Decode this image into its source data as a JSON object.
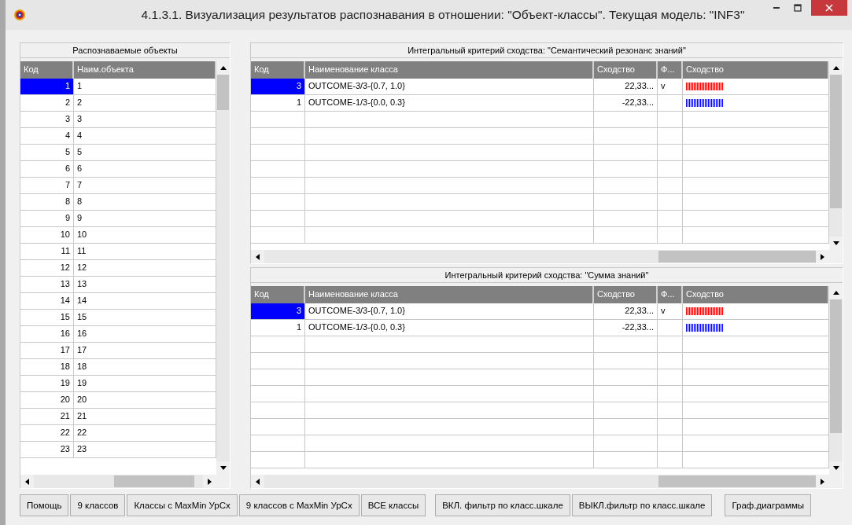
{
  "window": {
    "title": "4.1.3.1. Визуализация результатов распознавания в отношении: \"Объект-классы\". Текущая модель: \"INF3\""
  },
  "objects_panel": {
    "title": "Распознаваемые объекты",
    "columns": [
      "Код",
      "Наим.объекта"
    ],
    "rows": [
      {
        "code": "1",
        "name": "1",
        "selected": true
      },
      {
        "code": "2",
        "name": "2",
        "selected": false
      },
      {
        "code": "3",
        "name": "3",
        "selected": false
      },
      {
        "code": "4",
        "name": "4",
        "selected": false
      },
      {
        "code": "5",
        "name": "5",
        "selected": false
      },
      {
        "code": "6",
        "name": "6",
        "selected": false
      },
      {
        "code": "7",
        "name": "7",
        "selected": false
      },
      {
        "code": "8",
        "name": "8",
        "selected": false
      },
      {
        "code": "9",
        "name": "9",
        "selected": false
      },
      {
        "code": "10",
        "name": "10",
        "selected": false
      },
      {
        "code": "11",
        "name": "11",
        "selected": false
      },
      {
        "code": "12",
        "name": "12",
        "selected": false
      },
      {
        "code": "13",
        "name": "13",
        "selected": false
      },
      {
        "code": "14",
        "name": "14",
        "selected": false
      },
      {
        "code": "15",
        "name": "15",
        "selected": false
      },
      {
        "code": "16",
        "name": "16",
        "selected": false
      },
      {
        "code": "17",
        "name": "17",
        "selected": false
      },
      {
        "code": "18",
        "name": "18",
        "selected": false
      },
      {
        "code": "19",
        "name": "19",
        "selected": false
      },
      {
        "code": "20",
        "name": "20",
        "selected": false
      },
      {
        "code": "21",
        "name": "21",
        "selected": false
      },
      {
        "code": "22",
        "name": "22",
        "selected": false
      },
      {
        "code": "23",
        "name": "23",
        "selected": false
      }
    ]
  },
  "class_panels": [
    {
      "title": "Интегральный критерий сходства: \"Семантический резонанс знаний\"",
      "columns": [
        "Код",
        "Наименование класса",
        "Сходство",
        "Ф...",
        "Сходство"
      ],
      "rows": [
        {
          "code": "3",
          "name": "OUTCOME-3/3-{0.7, 1.0}",
          "similarity": "22,33...",
          "flag": "v",
          "color": "#ff0000",
          "selected": true
        },
        {
          "code": "1",
          "name": "OUTCOME-1/3-{0.0, 0.3}",
          "similarity": "-22,33...",
          "flag": "",
          "color": "#0000ff",
          "selected": false
        }
      ]
    },
    {
      "title": "Интегральный критерий сходства: \"Сумма знаний\"",
      "columns": [
        "Код",
        "Наименование класса",
        "Сходство",
        "Ф...",
        "Сходство"
      ],
      "rows": [
        {
          "code": "3",
          "name": "OUTCOME-3/3-{0.7, 1.0}",
          "similarity": "22,33...",
          "flag": "v",
          "color": "#ff0000",
          "selected": true
        },
        {
          "code": "1",
          "name": "OUTCOME-1/3-{0.0, 0.3}",
          "similarity": "-22,33...",
          "flag": "",
          "color": "#0000ff",
          "selected": false
        }
      ]
    }
  ],
  "buttons": [
    "Помощь",
    "9 классов",
    "Классы с MaxMin УрСх",
    "9 классов с MaxMin УрСх",
    "ВСЕ классы",
    "ВКЛ. фильтр по класс.шкале",
    "ВЫКЛ.фильтр по класс.шкале",
    "Граф.диаграммы"
  ]
}
